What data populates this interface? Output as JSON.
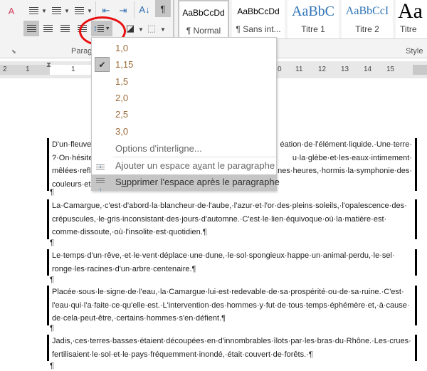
{
  "ribbon": {
    "paragraph_group_label": "Paragraphe",
    "styles_group_label": "Style",
    "styles": [
      {
        "preview": "AaBbCcDd",
        "name": "¶ Normal"
      },
      {
        "preview": "AaBbCcDd",
        "name": "¶ Sans int..."
      },
      {
        "preview": "AaBbC",
        "name": "Titre 1"
      },
      {
        "preview": "AaBbCcI",
        "name": "Titre 2"
      },
      {
        "preview": "Aa",
        "name": "Titre"
      }
    ],
    "icons": [
      "clear-formatting-icon",
      "bullets-icon",
      "numbering-icon",
      "multilevel-list-icon",
      "decrease-indent-icon",
      "increase-indent-icon",
      "sort-icon",
      "show-marks-icon",
      "align-left-icon",
      "center-icon",
      "align-right-icon",
      "justify-icon",
      "line-spacing-icon",
      "shading-icon",
      "borders-icon"
    ],
    "accent": "#2b579a",
    "highlight_circle_color": "#e81010"
  },
  "ruler": {
    "left_ticks": [
      "2",
      "1",
      "1"
    ],
    "right_ticks": [
      "0",
      "11",
      "12",
      "13",
      "14",
      "15"
    ]
  },
  "line_spacing_menu": {
    "options": [
      "1,0",
      "1,15",
      "1,5",
      "2,0",
      "2,5",
      "3,0"
    ],
    "selected": "1,15",
    "options_label": "Options d'interligne...",
    "add_before_pre": "Ajouter un espace a",
    "add_before_u": "v",
    "add_before_post": "ant le paragraphe",
    "remove_after_pre": "S",
    "remove_after_u": "u",
    "remove_after_post": "pprimer l'espace après le paragraphe"
  },
  "document": {
    "para1_visible": [
      {
        "left": "D'un·fleuve",
        "right": "éation·de·l'élément·liquide.·Une·terre·"
      },
      {
        "left": "?·On·hésite",
        "right": "u·la·glèbe·et·les·eaux·intimement·"
      },
      {
        "left": "mêlées·refl",
        "right": "nes·heures,·hormis·la·symphonie·des·"
      },
      {
        "left": "couleurs·et",
        "right": ""
      }
    ],
    "paragraphs": [
      "La·Camargue,·c'est·d'abord·la·blancheur·de·l'aube,·l'azur·et·l'or·des·pleins·soleils,·l'opalescence·des·crépuscules,·le·gris·inconsistant·des·jours·d'automne.·C'est·le·lien·équivoque·où·la·matière·est·comme·dissoute,·où·l'insolite·est·quotidien.¶",
      "Le·temps·d'un·rêve,·et·le·vent·déplace·une·dune,·le·sol·spongieux·happe·un·animal·perdu,·le·sel·ronge·les·racines·d'un·arbre·centenaire.¶",
      "Placée·sous·le·signe·de·l'eau,·la·Camargue·lui·est·redevable·de·sa·prospérité·ou·de·sa·ruine.·C'est·l'eau·qui·l'a·faite·ce·qu'elle·est.·L'intervention·des·hommes·y·fut·de·tous·temps·éphémère·et,·à·cause·de·cela·peut-être,·certains·hommes·s'en·défient.¶",
      "Jadis,·ces·terres·basses·étaient·découpées·en·d'innombrables·îlots·par·les·bras·du·Rhône.·Les·crues·fertilisaient·le·sol·et·le·pays·fréquemment·inondé,·était·couvert·de·forêts.·¶"
    ],
    "pilcrow": "¶"
  }
}
